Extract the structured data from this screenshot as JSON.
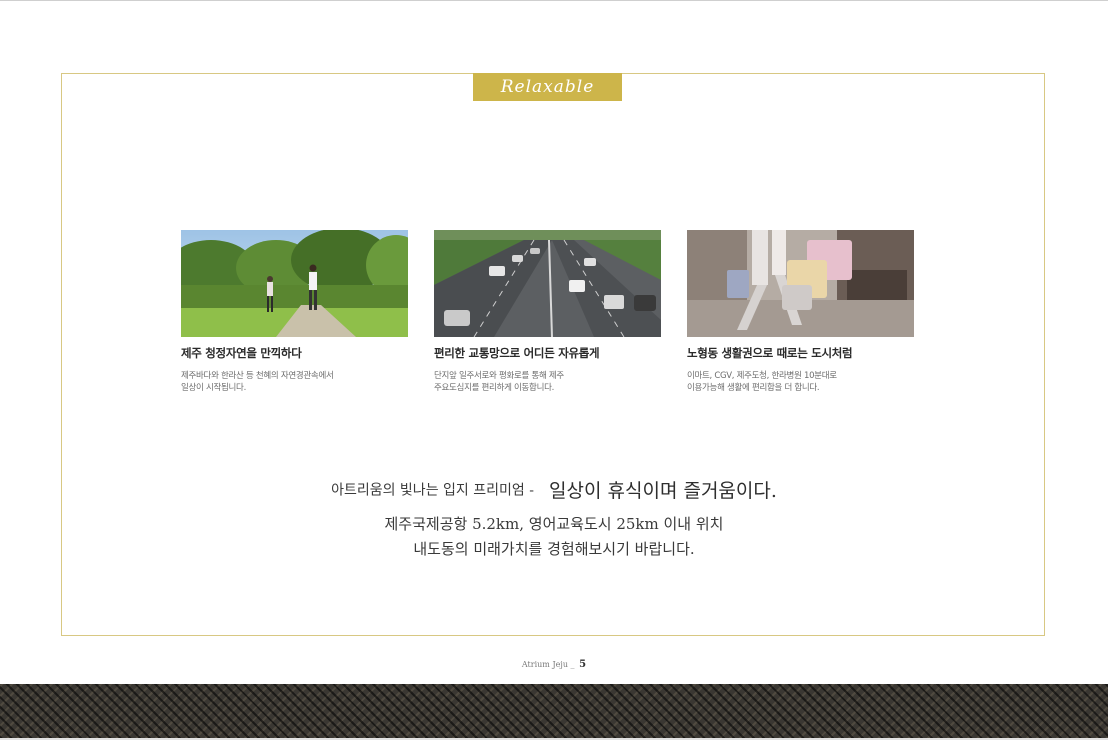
{
  "ribbon": {
    "label": "Relaxable"
  },
  "cards": [
    {
      "title": "제주 청정자연을 만끽하다",
      "desc_line1": "제주바다와 한라산 등 천혜의 자연경관속에서",
      "desc_line2": "일상이 시작됩니다.",
      "photo_icon": "jogging-park-photo"
    },
    {
      "title": "편리한 교통망으로 어디든 자유롭게",
      "desc_line1": "단지앞 일주서로와 평화로를 통해 제주",
      "desc_line2": "주요도심지를 편리하게  이동합니다.",
      "photo_icon": "highway-traffic-photo"
    },
    {
      "title": "노형동 생활권으로 때로는 도시처럼",
      "desc_line1": "이마트, CGV, 제주도청, 한라병원 10분대로",
      "desc_line2": "이용가능해 생활에 편리함을 더 합니다.",
      "photo_icon": "shopping-bags-photo"
    }
  ],
  "tagline": {
    "prefix": "아트리움의 빛나는 입지 프리미엄 -",
    "main": "일상이 휴식이며 즐거움이다."
  },
  "sub": {
    "line1": "제주국제공항 5.2km, 영어교육도시 25km 이내 위치",
    "line2": "내도동의 미래가치를 경험해보시기 바랍니다."
  },
  "folio": {
    "label": "Atrium Jeju _",
    "page": "5"
  },
  "colors": {
    "accent_gold": "#cdb54a",
    "frame_border": "#d8c883",
    "footer_band": "#3a3732"
  }
}
